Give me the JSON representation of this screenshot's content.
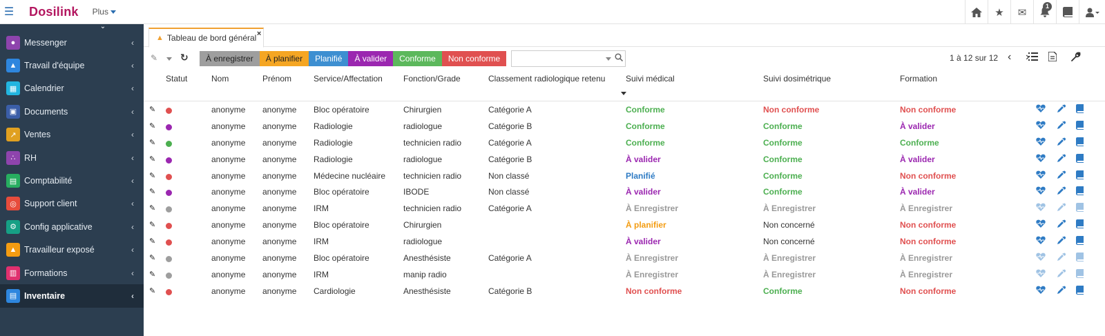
{
  "app": {
    "logo_text": "Dosilink",
    "plus_label": "Plus",
    "notification_count": "1"
  },
  "sidebar": {
    "items": [
      {
        "label": "Messenger",
        "color": "#8e44ad",
        "icon": "users-icon",
        "glyph": "●"
      },
      {
        "label": "Travail d'équipe",
        "color": "#2e86de",
        "icon": "user-icon",
        "glyph": "▲"
      },
      {
        "label": "Calendrier",
        "color": "#22b5e0",
        "icon": "calendar-icon",
        "glyph": "▦"
      },
      {
        "label": "Documents",
        "color": "#3b5ea8",
        "icon": "archive-icon",
        "glyph": "▣"
      },
      {
        "label": "Ventes",
        "color": "#e0a020",
        "icon": "chart-line-icon",
        "glyph": "↗"
      },
      {
        "label": "RH",
        "color": "#8e44ad",
        "icon": "sitemap-icon",
        "glyph": "∴"
      },
      {
        "label": "Comptabilité",
        "color": "#27ae60",
        "icon": "calculator-icon",
        "glyph": "▤"
      },
      {
        "label": "Support client",
        "color": "#e74c3c",
        "icon": "life-ring-icon",
        "glyph": "◎"
      },
      {
        "label": "Config applicative",
        "color": "#16a085",
        "icon": "cog-icon",
        "glyph": "⚙"
      },
      {
        "label": "Travailleur exposé",
        "color": "#f39c12",
        "icon": "user-shield-icon",
        "glyph": "▲"
      },
      {
        "label": "Formations",
        "color": "#e0306f",
        "icon": "book-icon",
        "glyph": "▥"
      },
      {
        "label": "Inventaire",
        "color": "#2e86de",
        "icon": "inbox-icon",
        "glyph": "▤",
        "active": true
      }
    ]
  },
  "tab": {
    "label": "Tableau de bord général"
  },
  "toolbar": {
    "filters": [
      {
        "label": "À enregistrer",
        "color": "#9e9e9e",
        "text_color": "#222"
      },
      {
        "label": "À planifier",
        "color": "#f5a623",
        "text_color": "#222"
      },
      {
        "label": "Planifié",
        "color": "#3d8fd1",
        "text_color": "#ffffff"
      },
      {
        "label": "À valider",
        "color": "#9b27b0",
        "text_color": "#ffffff"
      },
      {
        "label": "Conforme",
        "color": "#5cb85c",
        "text_color": "#ffffff"
      },
      {
        "label": "Non conforme",
        "color": "#e05050",
        "text_color": "#ffffff"
      }
    ],
    "search_value": "",
    "pagination_text": "1 à 12 sur 12"
  },
  "table": {
    "headers": {
      "statut": "Statut",
      "nom": "Nom",
      "prenom": "Prénom",
      "service": "Service/Affectation",
      "fonction": "Fonction/Grade",
      "classement": "Classement radiologique retenu",
      "suivi_medical": "Suivi médical",
      "suivi_dosimetrique": "Suivi dosimétrique",
      "formation": "Formation"
    },
    "status_colors": {
      "Conforme": "#4caf50",
      "Non conforme": "#e05050",
      "À valider": "#9b27b0",
      "Planifié": "#2e7bc4",
      "À planifier": "#f39c12",
      "À Enregistrer": "#999999",
      "Non concerné": "#333333"
    },
    "rows": [
      {
        "dot": "#e05050",
        "nom": "anonyme",
        "prenom": "anonyme",
        "service": "Bloc opératoire",
        "fonction": "Chirurgien",
        "classement": "Catégorie A",
        "medical": "Conforme",
        "dosimetrique": "Non conforme",
        "formation": "Non conforme",
        "enabled": true
      },
      {
        "dot": "#9b27b0",
        "nom": "anonyme",
        "prenom": "anonyme",
        "service": "Radiologie",
        "fonction": "radiologue",
        "classement": "Catégorie B",
        "medical": "Conforme",
        "dosimetrique": "Conforme",
        "formation": "À valider",
        "enabled": true
      },
      {
        "dot": "#4caf50",
        "nom": "anonyme",
        "prenom": "anonyme",
        "service": "Radiologie",
        "fonction": "technicien radio",
        "classement": "Catégorie A",
        "medical": "Conforme",
        "dosimetrique": "Conforme",
        "formation": "Conforme",
        "enabled": true
      },
      {
        "dot": "#9b27b0",
        "nom": "anonyme",
        "prenom": "anonyme",
        "service": "Radiologie",
        "fonction": "radiologue",
        "classement": "Catégorie B",
        "medical": "À valider",
        "dosimetrique": "Conforme",
        "formation": "À valider",
        "enabled": true
      },
      {
        "dot": "#e05050",
        "nom": "anonyme",
        "prenom": "anonyme",
        "service": "Médecine nucléaire",
        "fonction": "technicien radio",
        "classement": "Non classé",
        "medical": "Planifié",
        "dosimetrique": "Conforme",
        "formation": "Non conforme",
        "enabled": true
      },
      {
        "dot": "#9b27b0",
        "nom": "anonyme",
        "prenom": "anonyme",
        "service": "Bloc opératoire",
        "fonction": "IBODE",
        "classement": "Non classé",
        "medical": "À valider",
        "dosimetrique": "Conforme",
        "formation": "À valider",
        "enabled": true
      },
      {
        "dot": "#9e9e9e",
        "nom": "anonyme",
        "prenom": "anonyme",
        "service": "IRM",
        "fonction": "technicien radio",
        "classement": "Catégorie A",
        "medical": "À Enregistrer",
        "dosimetrique": "À Enregistrer",
        "formation": "À Enregistrer",
        "enabled": false
      },
      {
        "dot": "#e05050",
        "nom": "anonyme",
        "prenom": "anonyme",
        "service": "Bloc opératoire",
        "fonction": "Chirurgien",
        "classement": "",
        "medical": "À planifier",
        "dosimetrique": "Non concerné",
        "formation": "Non conforme",
        "enabled": true
      },
      {
        "dot": "#e05050",
        "nom": "anonyme",
        "prenom": "anonyme",
        "service": "IRM",
        "fonction": "radiologue",
        "classement": "",
        "medical": "À valider",
        "dosimetrique": "Non concerné",
        "formation": "Non conforme",
        "enabled": true
      },
      {
        "dot": "#9e9e9e",
        "nom": "anonyme",
        "prenom": "anonyme",
        "service": "Bloc opératoire",
        "fonction": "Anesthésiste",
        "classement": "Catégorie A",
        "medical": "À Enregistrer",
        "dosimetrique": "À Enregistrer",
        "formation": "À Enregistrer",
        "enabled": false
      },
      {
        "dot": "#9e9e9e",
        "nom": "anonyme",
        "prenom": "anonyme",
        "service": "IRM",
        "fonction": "manip radio",
        "classement": "",
        "medical": "À Enregistrer",
        "dosimetrique": "À Enregistrer",
        "formation": "À Enregistrer",
        "enabled": false
      },
      {
        "dot": "#e05050",
        "nom": "anonyme",
        "prenom": "anonyme",
        "service": "Cardiologie",
        "fonction": "Anesthésiste",
        "classement": "Catégorie B",
        "medical": "Non conforme",
        "dosimetrique": "Conforme",
        "formation": "Non conforme",
        "enabled": true
      }
    ]
  }
}
